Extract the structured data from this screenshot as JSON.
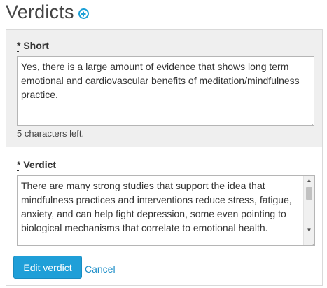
{
  "header": {
    "title": "Verdicts",
    "add_icon": "add-circle-icon"
  },
  "short_field": {
    "required_marker": "*",
    "label": "Short",
    "value": "Yes, there is a large amount of evidence that shows long term emotional and cardiovascular benefits of meditation/mindfulness practice.",
    "chars_left": "5 characters left."
  },
  "verdict_field": {
    "required_marker": "*",
    "label": "Verdict",
    "value": "There are many strong studies that support the idea that mindfulness practices and interventions reduce stress, fatigue, anxiety, and can help fight depression, some even pointing to biological mechanisms that correlate to emotional health."
  },
  "actions": {
    "submit_label": "Edit verdict",
    "cancel_label": "Cancel"
  },
  "colors": {
    "accent": "#1f9fd8",
    "panel_bg": "#efefef"
  }
}
